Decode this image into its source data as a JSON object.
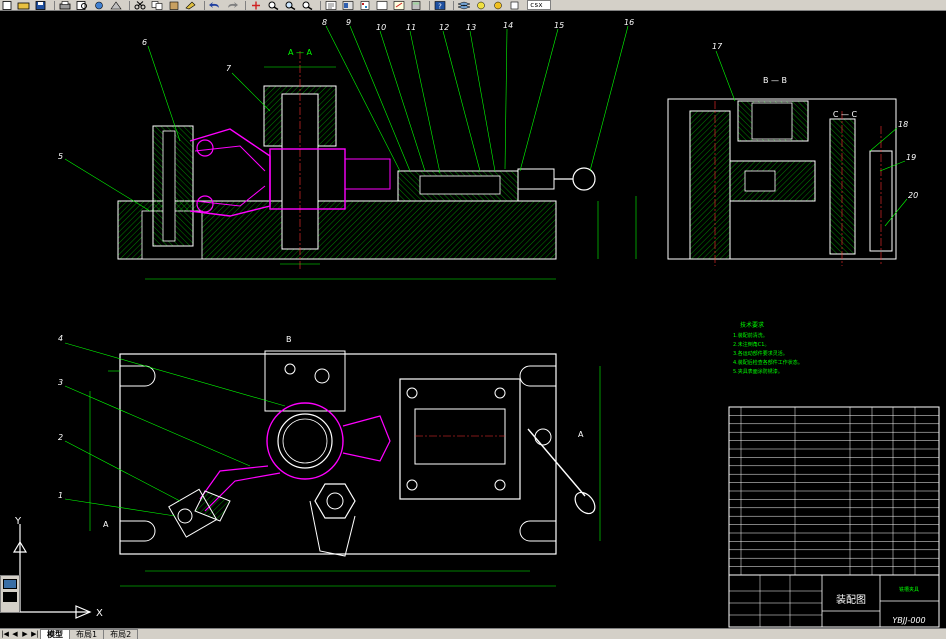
{
  "toolbar": {
    "layer_value": "csx",
    "colors": {
      "bg": "#d4d0c8"
    }
  },
  "drawing": {
    "section_aa": "A — A",
    "section_bb": "B — B",
    "section_cc": "C — C",
    "part_numbers_top": [
      "6",
      "7",
      "8",
      "9",
      "10",
      "11",
      "12",
      "13",
      "14",
      "15",
      "16",
      "17",
      "18",
      "19",
      "20"
    ],
    "part_numbers_left": [
      "5",
      "4",
      "3",
      "2",
      "1"
    ],
    "view_marker_a": "A",
    "view_marker_b": "B",
    "tech_req_title": "技术要求",
    "tech_req_lines": [
      "1.装配前清洗。",
      "2.未注倒角C1。",
      "3.各运动部件要求灵活。",
      "4.装配后检查各部件工作状态。",
      "5.夹具表面涂防锈漆。"
    ],
    "title_block": {
      "drawing_title": "装配图",
      "drawing_number": "YBJJ-000",
      "product_name": "铣槽夹具"
    },
    "colors": {
      "line_white": "#ffffff",
      "line_green": "#00ff00",
      "line_magenta": "#ff00ff",
      "line_red": "#ff3030",
      "line_yellow": "#ffff00",
      "line_cyan": "#00ffff"
    }
  },
  "tabs": {
    "items": [
      "模型",
      "布局1",
      "布局2"
    ],
    "active": "模型"
  },
  "ucs": {
    "x_label": "X",
    "y_label": "Y"
  }
}
